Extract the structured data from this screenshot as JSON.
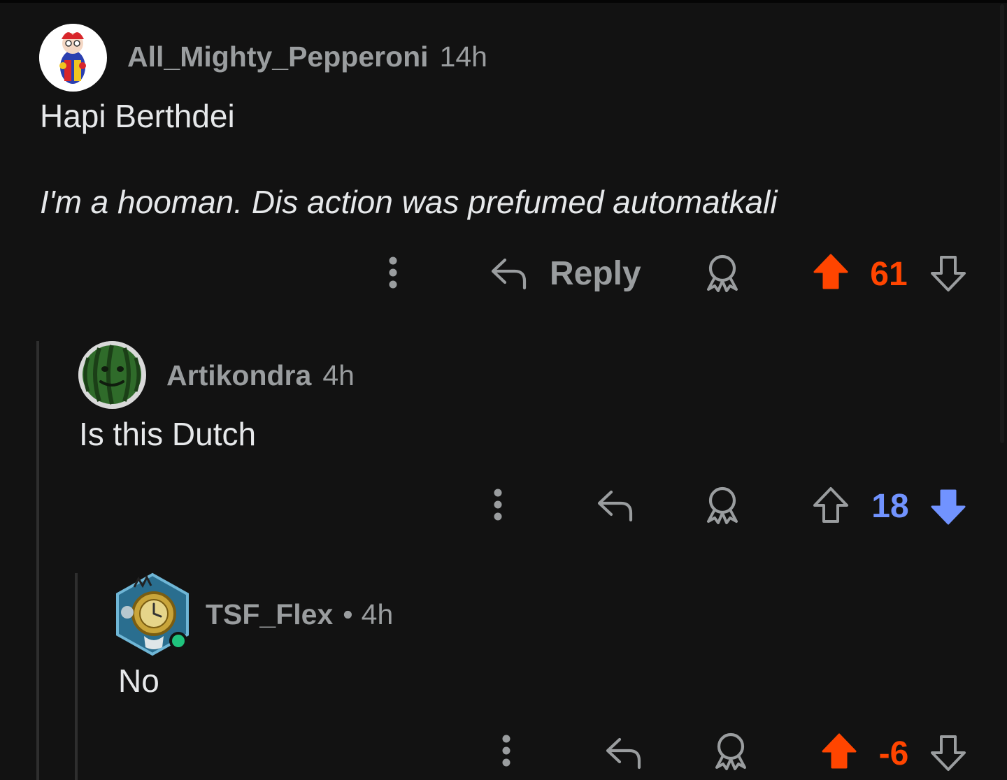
{
  "colors": {
    "background": "#121212",
    "text": "#e6e8ea",
    "meta": "#9a9d9f",
    "upvote": "#ff4500",
    "downvote": "#7193ff",
    "online": "#1fc37d"
  },
  "comments": [
    {
      "username": "All_Mighty_Pepperoni",
      "time": "14h",
      "body": [
        "Hapi Berthdei",
        "I'm a hooman. Dis action was prefumed automatkali"
      ],
      "reply_label": "Reply",
      "score": "61",
      "vote_state": "upvoted",
      "icons": [
        "more-icon",
        "reply-icon",
        "award-icon",
        "upvote-icon",
        "downvote-icon"
      ]
    },
    {
      "username": "Artikondra",
      "time": "4h",
      "body": [
        "Is this Dutch"
      ],
      "score": "18",
      "vote_state": "downvoted",
      "icons": [
        "more-icon",
        "reply-icon",
        "award-icon",
        "upvote-icon",
        "downvote-icon"
      ]
    },
    {
      "username": "TSF_Flex",
      "separator": "•",
      "time": "4h",
      "body": [
        "No"
      ],
      "score": "-6",
      "vote_state": "upvoted",
      "online": true,
      "icons": [
        "more-icon",
        "reply-icon",
        "award-icon",
        "upvote-icon",
        "downvote-icon"
      ]
    }
  ]
}
